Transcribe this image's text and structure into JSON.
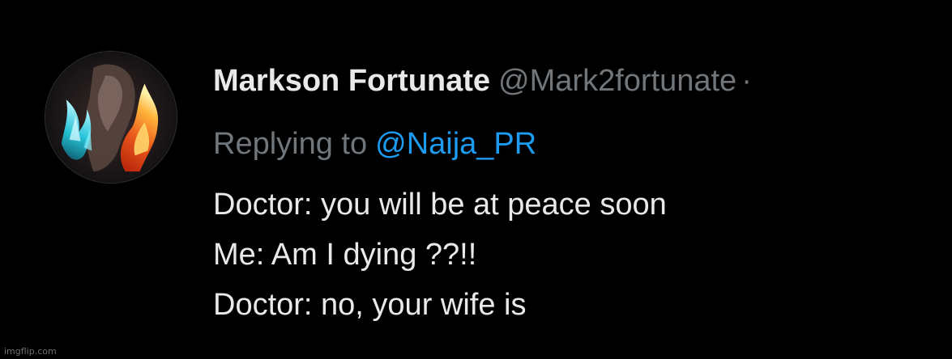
{
  "tweet": {
    "author": {
      "display_name": "Markson Fortunate",
      "handle": "@Mark2fortunate",
      "separator": "·"
    },
    "reply": {
      "prefix": "Replying to",
      "mention": "@Naija_PR"
    },
    "lines": [
      "Doctor: you will be at peace soon",
      "Me: Am I dying ??!!",
      "Doctor: no, your wife is"
    ]
  },
  "watermark": "imgflip.com",
  "colors": {
    "background": "#000000",
    "primary_text": "#e7e9ea",
    "secondary_text": "#71767b",
    "link": "#1d9bf0"
  },
  "icons": {
    "avatar": "avatar-image"
  }
}
